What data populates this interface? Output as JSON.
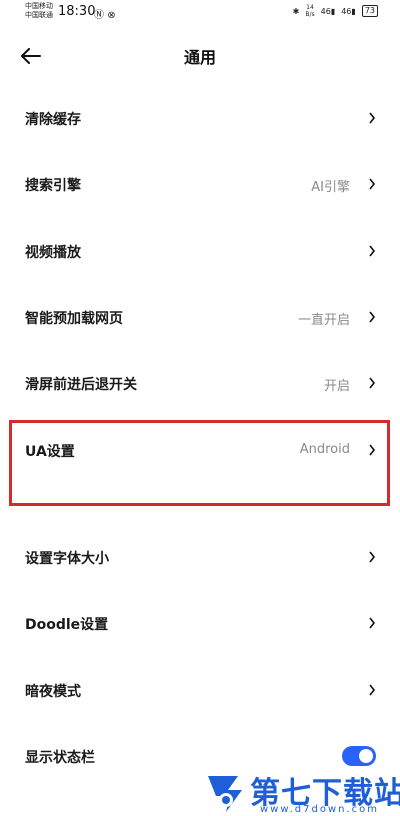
{
  "status_bar": {
    "carrier_1": "中国移动",
    "carrier_2": "中国联通",
    "time": "18:30",
    "net_speed_value": "14",
    "net_speed_unit": "B/s",
    "signal_1": "46",
    "signal_2": "46",
    "battery": "73"
  },
  "header": {
    "title": "通用"
  },
  "settings": {
    "clear_cache": {
      "label": "清除缓存"
    },
    "search_engine": {
      "label": "搜索引擎",
      "value": "AI引擎"
    },
    "video_playback": {
      "label": "视频播放"
    },
    "smart_preload": {
      "label": "智能预加载网页",
      "value": "一直开启"
    },
    "swipe_nav": {
      "label": "滑屏前进后退开关",
      "value": "开启"
    },
    "ua_setting": {
      "label": "UA设置",
      "value": "Android"
    },
    "font_size": {
      "label": "设置字体大小"
    },
    "doodle": {
      "label": "Doodle设置"
    },
    "dark_mode": {
      "label": "暗夜模式"
    },
    "status_bar_toggle": {
      "label": "显示状态栏",
      "on": true
    }
  },
  "colors": {
    "highlight": "#d42b2b",
    "toggle_on": "#2962ff",
    "watermark": "#1e5fd6"
  },
  "watermark": {
    "brand": "第七下载站",
    "url": "www.d7down.com"
  }
}
